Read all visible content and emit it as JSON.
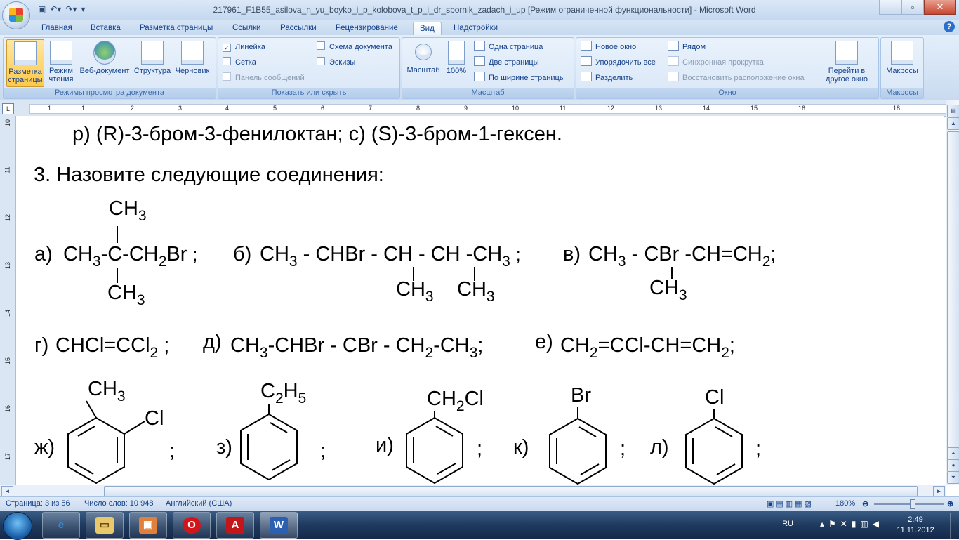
{
  "window": {
    "title": "217961_F1B55_asilova_n_yu_boyko_i_p_kolobova_t_p_i_dr_sbornik_zadach_i_up [Режим ограниченной функциональности] - Microsoft Word"
  },
  "tabs": [
    "Главная",
    "Вставка",
    "Разметка страницы",
    "Ссылки",
    "Рассылки",
    "Рецензирование",
    "Вид",
    "Надстройки"
  ],
  "active_tab": "Вид",
  "ribbon": {
    "views": {
      "label": "Режимы просмотра документа",
      "buttons": [
        "Разметка страницы",
        "Режим чтения",
        "Веб-документ",
        "Структура",
        "Черновик"
      ]
    },
    "show": {
      "label": "Показать или скрыть",
      "ruler": "Линейка",
      "grid": "Сетка",
      "messages": "Панель сообщений",
      "docmap": "Схема документа",
      "thumbnails": "Эскизы"
    },
    "zoom": {
      "label": "Масштаб",
      "zoom_btn": "Масштаб",
      "zoom100": "100%",
      "one_page": "Одна страница",
      "two_pages": "Две страницы",
      "page_width": "По ширине страницы"
    },
    "window": {
      "label": "Окно",
      "new_window": "Новое окно",
      "arrange_all": "Упорядочить все",
      "split": "Разделить",
      "side_by_side": "Рядом",
      "sync_scroll": "Синхронная прокрутка",
      "reset_pos": "Восстановить расположение окна",
      "switch": "Перейти в другое окно"
    },
    "macros": {
      "label": "Макросы",
      "btn": "Макросы"
    }
  },
  "ruler": {
    "corner": "L",
    "ticks": [
      "1",
      "1",
      "2",
      "3",
      "4",
      "5",
      "6",
      "7",
      "8",
      "9",
      "10",
      "11",
      "12",
      "13",
      "14",
      "15",
      "16",
      "18"
    ],
    "vticks": [
      "10",
      "11",
      "12",
      "13",
      "14",
      "15",
      "16",
      "17"
    ]
  },
  "document": {
    "line1": "р) (R)-3-бром-3-фенилоктан; с) (S)-3-бром-1-гексен.",
    "heading": "3. Назовите следующие соединения:",
    "ch3": "CH",
    "sub3": "3",
    "a_label": "а)",
    "a_ch3": "CH",
    "a_c": "-C-CH",
    "a_br": "Br",
    "semi": ";",
    "b_label": "б)",
    "b_text1": "CH",
    "b_text2": " - CHBr - CH - CH -CH",
    "v_label": "в)",
    "v_text1": "CH",
    "v_text2": " - CBr -CH=CH",
    "g_label": "г)",
    "g_text": "CHCl=CCl",
    "sub2": "2",
    "d_label": "д)",
    "d_text1": "CH",
    "d_text2": "-CHBr - CBr - CH",
    "d_text3": "-CH",
    "e_label": "е)",
    "e_text1": "CH",
    "e_text2": "=CCl-CH=CH",
    "zh_label": "ж)",
    "z_label": "з)",
    "i_label": "и)",
    "k_label": "к)",
    "l_label": "л)",
    "cl": "Cl",
    "br": "Br",
    "c2h5_c": "C",
    "c2h5_h": "H",
    "sub5": "5",
    "ch2cl_a": "CH",
    "ch2cl_b": "Cl"
  },
  "status": {
    "page": "Страница: 3 из 56",
    "words": "Число слов: 10 948",
    "lang": "Английский (США)",
    "zoom": "180%"
  },
  "tray": {
    "lang": "RU",
    "time": "2:49",
    "date": "11.11.2012"
  }
}
